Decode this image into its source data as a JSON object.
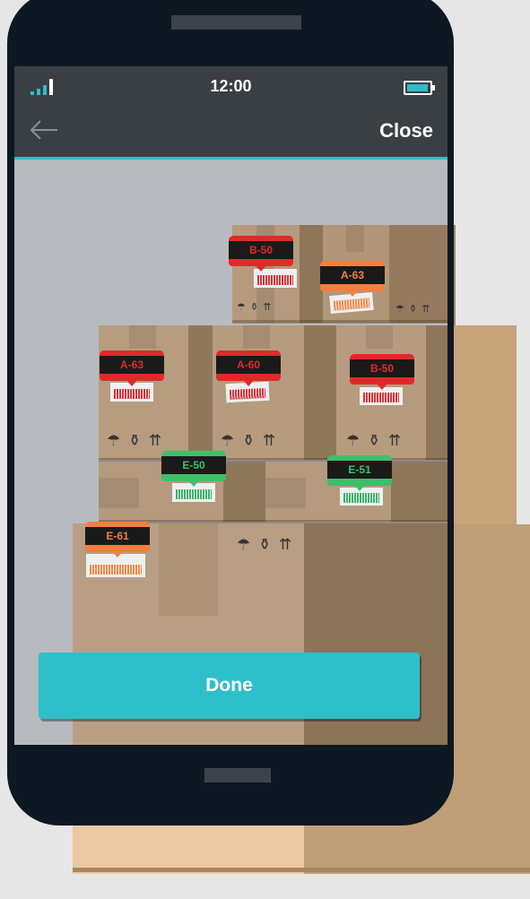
{
  "status_bar": {
    "time": "12:00"
  },
  "nav": {
    "close_label": "Close"
  },
  "tags": [
    {
      "label": "B-50",
      "color": "#e02a2a",
      "barcode": "#d9333a"
    },
    {
      "label": "A-63",
      "color": "#f47f3e",
      "barcode": "#f08a4b"
    },
    {
      "label": "A-63",
      "color": "#e02a2a",
      "barcode": "#d9333a"
    },
    {
      "label": "A-60",
      "color": "#e02a2a",
      "barcode": "#d9333a"
    },
    {
      "label": "B-50",
      "color": "#e02a2a",
      "barcode": "#d9333a"
    },
    {
      "label": "E-50",
      "color": "#3fbf6a",
      "barcode": "#3fb26a"
    },
    {
      "label": "E-51",
      "color": "#3fbf6a",
      "barcode": "#3fb26a"
    },
    {
      "label": "E-61",
      "color": "#f47f3e",
      "barcode": "#f08a4b"
    }
  ],
  "box_glyphs": "☂ ⚱ ⇈",
  "done_label": "Done",
  "colors": {
    "accent": "#2fbfca",
    "phone": "#0e1823",
    "bar": "#3a3f44"
  }
}
